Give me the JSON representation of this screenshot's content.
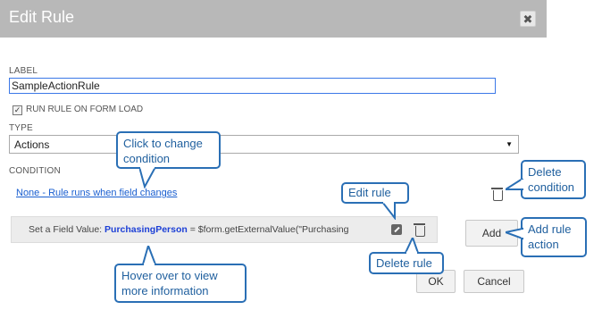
{
  "dialog": {
    "title": "Edit Rule",
    "close_glyph": "✖",
    "label_heading": "LABEL",
    "label_value": "SampleActionRule",
    "run_on_load_label": "RUN RULE ON FORM LOAD",
    "run_on_load_checked": true,
    "type_heading": "TYPE",
    "type_value": "Actions",
    "type_arrow": "▼",
    "condition_heading": "CONDITION",
    "condition_link": "None - Rule runs when field changes",
    "action": {
      "prefix": "Set a Field Value:",
      "field": "PurchasingPerson",
      "expression": "= $form.getExternalValue(\"Purchasing"
    },
    "add_button": "Add",
    "ok_button": "OK",
    "cancel_button": "Cancel"
  },
  "icons": {
    "close": "close-icon",
    "checkbox": "checkbox-icon",
    "edit": "edit-icon",
    "delete": "trash-icon",
    "dropdown": "chevron-down-icon"
  },
  "callouts": {
    "change_condition": "Click to change condition",
    "delete_condition": "Delete condition",
    "edit_rule": "Edit rule",
    "add_rule_action": "Add rule action",
    "delete_rule": "Delete rule",
    "hover_info": "Hover over to view more information"
  },
  "colors": {
    "titlebar": "#b8b8b8",
    "callout_border": "#2a6fb5",
    "callout_text": "#1f5f9e",
    "link": "#1a5fd0",
    "field_name": "#1c3fd6",
    "input_focus": "#3b78e7"
  }
}
